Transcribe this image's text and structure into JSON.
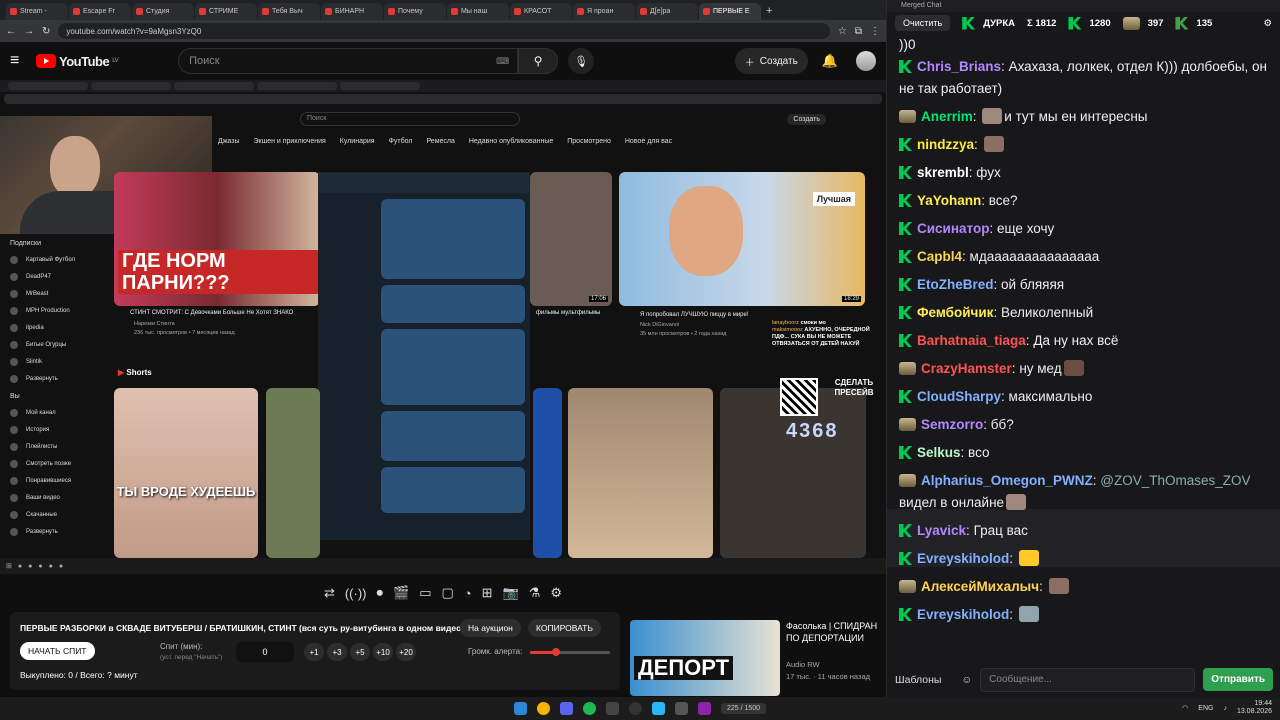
{
  "browser": {
    "tabs": [
      "Stream -",
      "Escape Fr",
      "Студия",
      "СТРИМЕ",
      "Тебя Выч",
      "БИНАРН",
      "Почему",
      "Мы наш",
      "КРАСОТ",
      "Я проан",
      "Д[e]ра",
      "ПЕРВЫЕ Е"
    ],
    "active_tab": 11,
    "url": "youtube.com/watch?v=9aMgsn3YzQ0"
  },
  "youtube": {
    "logo_text": "YouTube",
    "logo_region": "LV",
    "search_placeholder": "Поиск",
    "create_label": "Создать"
  },
  "inner_page": {
    "search_placeholder": "Поиск",
    "create_label": "Создать",
    "chips": [
      "Джазы",
      "Экшен и приключения",
      "Кулинария",
      "Футбол",
      "Ремесла",
      "Недавно опубликованные",
      "Просмотрено",
      "Новое для вас"
    ],
    "subs_header": "Подписки",
    "subs": [
      "Картавый Футбол",
      "DeadP47",
      "MrBeast",
      "MPH Production",
      "itpedia",
      "Битые Огурцы",
      "Slintik",
      "Развернуть"
    ],
    "you_header": "Вы",
    "you_items": [
      "Мой канал",
      "История",
      "Плейлисты",
      "Смотреть позже",
      "Понравившиеся",
      "Ваши видео",
      "Скачанные",
      "Развернуть"
    ],
    "video1": {
      "caption": "ГДЕ НОРМ ПАРНИ???",
      "title": "СТИНТ СМОТРИТ: С Девочками Больше Не Хотят ЗНАКО",
      "channel": "Нарезки Стинта",
      "meta": "236 тыс. просмотров • 7 месяцев назад"
    },
    "video2": {
      "title": "фильмы мультфильмы",
      "duration": "17:06"
    },
    "video3": {
      "label": "Лучшая",
      "title": "Я попробовал ЛУЧШУЮ пиццу в мире!",
      "channel": "Nick DiGiovanni",
      "meta": "35 млн просмотров • 2 года назад",
      "duration": "18:29"
    },
    "shorts_header": "Shorts",
    "short1_caption": "ТЫ ВРОДЕ ХУДЕЕШЬ",
    "qr_text": "СДЕЛАТЬ ПРЕСЕЙВ",
    "counter": "4368",
    "overlay_chat": [
      {
        "user": "lanayboorz",
        "text": "смоки мо"
      },
      {
        "user": "maksimoooz",
        "text": "АХУЕННО, ОЧЕРЕДНОЙ ПДФ... СУКА ВЫ НЕ МОЖЕТЕ ОТВЯЗАТЬСЯ ОТ ДЕТЕЙ НАХУЙ"
      }
    ]
  },
  "toolbar_icons": [
    "shuffle-icon",
    "broadcast-icon",
    "record-icon",
    "clapper-icon",
    "crop-icon",
    "window-icon",
    "gauge-icon",
    "add-icon",
    "camera-icon",
    "flask-icon",
    "gear-icon"
  ],
  "auction": {
    "title": "ПЕРВЫЕ РАЗБОРКИ в СКВАДЕ ВИТУБЕРШ / БРАТИШКИН, СТИНТ (вся суть ру-витубинга в одном видео)",
    "auction_btn": "На аукцион",
    "copy_btn": "КОПИРОВАТЬ",
    "start_btn": "НАЧАТЬ СПИТ",
    "time_label": "Спит (мин):",
    "time_sub": "(уст. перед \"Начать\")",
    "time_value": "0",
    "increments": [
      "+1",
      "+3",
      "+5",
      "+10",
      "+20"
    ],
    "volume_label": "Громк. алерта:",
    "volume_level": 0.32,
    "footer": "Выкуплено: 0 / Всего: ? минут"
  },
  "recommended": {
    "thumb_caption": "ДЕПОРТ",
    "title": "Фасолька | СПИДРАН ПО ДЕПОРТАЦИИ",
    "channel": "Audio RW",
    "meta": "17 тыс. · 11 часов назад"
  },
  "taskbar": {
    "lang": "ENG",
    "time": "19:44",
    "date": "13.08.2026",
    "widget_text": "225 / 1500"
  },
  "chat": {
    "window_title": "Merged Chat",
    "clear_btn": "Очистить",
    "streamer": "ДУРКА",
    "stats": [
      {
        "icon": "sigma",
        "value": "Σ 1812"
      },
      {
        "icon": "kick",
        "value": "1280"
      },
      {
        "icon": "twitch-sub",
        "value": "397"
      },
      {
        "icon": "vk",
        "value": "135"
      }
    ],
    "messages": [
      {
        "badge": "",
        "user": "",
        "text": "))0",
        "color": "#efeff1"
      },
      {
        "badge": "k",
        "user": "Chris_Brians",
        "text": "Ахахаза, лолкек, отдел К))) долбоебы, он не так работает)",
        "color": "#b388ff"
      },
      {
        "badge": "sub",
        "user": "Anerrim",
        "text": "и тут мы ен интересны",
        "color": "#00e676"
      },
      {
        "badge": "k",
        "user": "nindzzya",
        "text": "",
        "color": "#ffeb3b"
      },
      {
        "badge": "k",
        "user": "skrembl",
        "text": "фух",
        "color": "#ffffff"
      },
      {
        "badge": "k",
        "user": "YaYohann",
        "text": "все?",
        "color": "#ffee58"
      },
      {
        "badge": "k",
        "user": "Сисинатор",
        "text": "еще хочу",
        "color": "#b388ff"
      },
      {
        "badge": "k",
        "user": "Capbl4",
        "text": "мдааааааааааааааа",
        "color": "#ffd54f"
      },
      {
        "badge": "k",
        "user": "EtoZheBred",
        "text": "ой бляяяя",
        "color": "#82b1ff"
      },
      {
        "badge": "k",
        "user": "Фембойчик",
        "text": "Великолепный",
        "color": "#ffee58"
      },
      {
        "badge": "k",
        "user": "Barhatnaia_tiaga",
        "text": "Да ну нах всё",
        "color": "#ff5252"
      },
      {
        "badge": "sub",
        "user": "CrazyHamster",
        "text": "ну мед",
        "color": "#ff5252"
      },
      {
        "badge": "k",
        "user": "CloudSharpy",
        "text": "максимально",
        "color": "#82b1ff"
      },
      {
        "badge": "sub",
        "user": "Semzorro",
        "text": "бб?",
        "color": "#b388ff"
      },
      {
        "badge": "k",
        "user": "Selkus",
        "text": "всо",
        "color": "#b9f6ca"
      },
      {
        "badge": "sub",
        "user": "Alpharius_Omegon_PWNZ",
        "mention": "@ZOV_ThOmases_ZOV",
        "text": "видел в онлайне",
        "color": "#82b1ff"
      },
      {
        "badge": "k",
        "user": "Lyavick",
        "text": "Грац вас",
        "color": "#b388ff"
      },
      {
        "badge": "k",
        "user": "Evreyskiholod",
        "text": "",
        "color": "#82b1ff"
      },
      {
        "badge": "sub",
        "user": "АлексейМихалыч",
        "text": "",
        "color": "#ffd54f"
      },
      {
        "badge": "k",
        "user": "Evreyskiholod",
        "text": "",
        "color": "#82b1ff"
      }
    ],
    "templates_btn": "Шаблоны",
    "input_placeholder": "Сообщение...",
    "send_btn": "Отправить"
  }
}
